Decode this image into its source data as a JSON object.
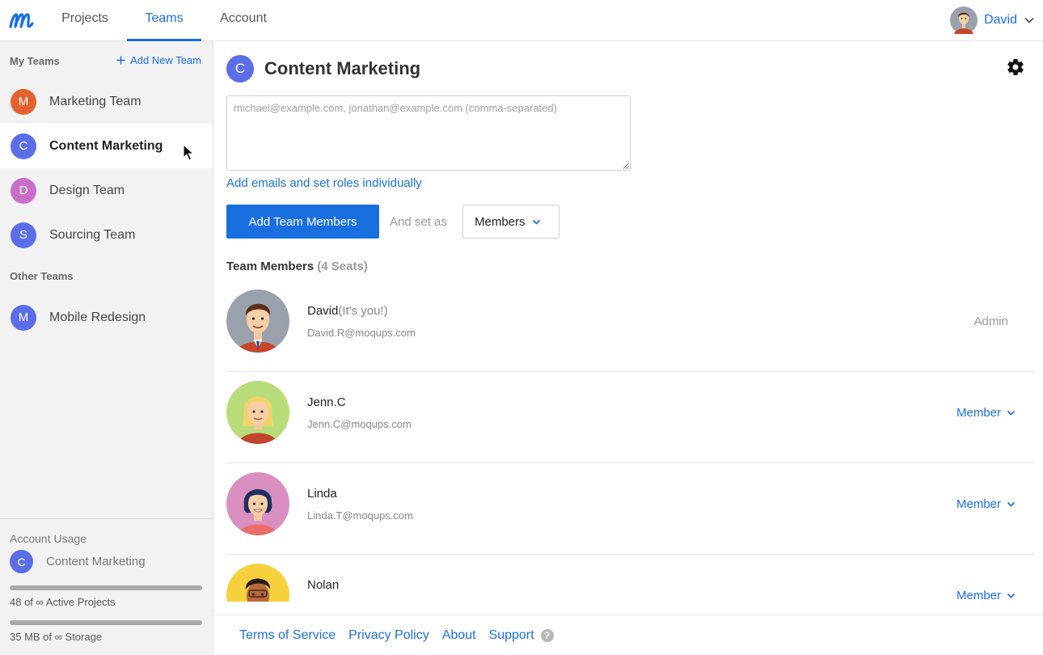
{
  "nav": {
    "logo_icon": "moqups-logo-icon",
    "tabs": [
      {
        "label": "Projects"
      },
      {
        "label": "Teams",
        "active": true
      },
      {
        "label": "Account"
      }
    ],
    "user_name": "David"
  },
  "sidebar": {
    "my_teams_label": "My Teams",
    "add_team_label": "Add New Team",
    "my_teams": [
      {
        "initial": "M",
        "name": "Marketing Team",
        "color": "#e4622f"
      },
      {
        "initial": "C",
        "name": "Content Marketing",
        "color": "#5b6ee8",
        "active": true
      },
      {
        "initial": "D",
        "name": "Design Team",
        "color": "#c96fc9"
      },
      {
        "initial": "S",
        "name": "Sourcing Team",
        "color": "#5b6ee8"
      }
    ],
    "other_teams_label": "Other Teams",
    "other_teams": [
      {
        "initial": "M",
        "name": "Mobile Redesign",
        "color": "#5b6ee8"
      }
    ],
    "usage": {
      "title": "Account Usage",
      "team_initial": "C",
      "team_name": "Content Marketing",
      "projects_label": "48 of ∞ Active Projects",
      "storage_label": "35 MB of ∞ Storage"
    }
  },
  "main": {
    "team_initial": "C",
    "team_title": "Content Marketing",
    "emails_placeholder": "michael@example.com, jonathan@example.com (comma-separated)",
    "add_individually_label": "Add emails and set roles individually",
    "add_button_label": "Add Team Members",
    "set_as_label": "And set as",
    "role_select_value": "Members",
    "members_heading": "Team Members",
    "seats_label": "(4 Seats)",
    "members": [
      {
        "name": "David",
        "you_label": "(It's you!)",
        "email": "David.R@moqups.com",
        "role": "Admin",
        "role_editable": false
      },
      {
        "name": "Jenn.C",
        "email": "Jenn.C@moqups.com",
        "role": "Member",
        "role_editable": true
      },
      {
        "name": "Linda",
        "email": "Linda.T@moqups.com",
        "role": "Member",
        "role_editable": true
      },
      {
        "name": "Nolan",
        "email": "",
        "role": "Member",
        "role_editable": true
      }
    ]
  },
  "footer": {
    "links": [
      "Terms of Service",
      "Privacy Policy",
      "About",
      "Support"
    ],
    "help_glyph": "?"
  },
  "colors": {
    "accent": "#1a6fe0",
    "team_blue": "#5b6ee8"
  }
}
